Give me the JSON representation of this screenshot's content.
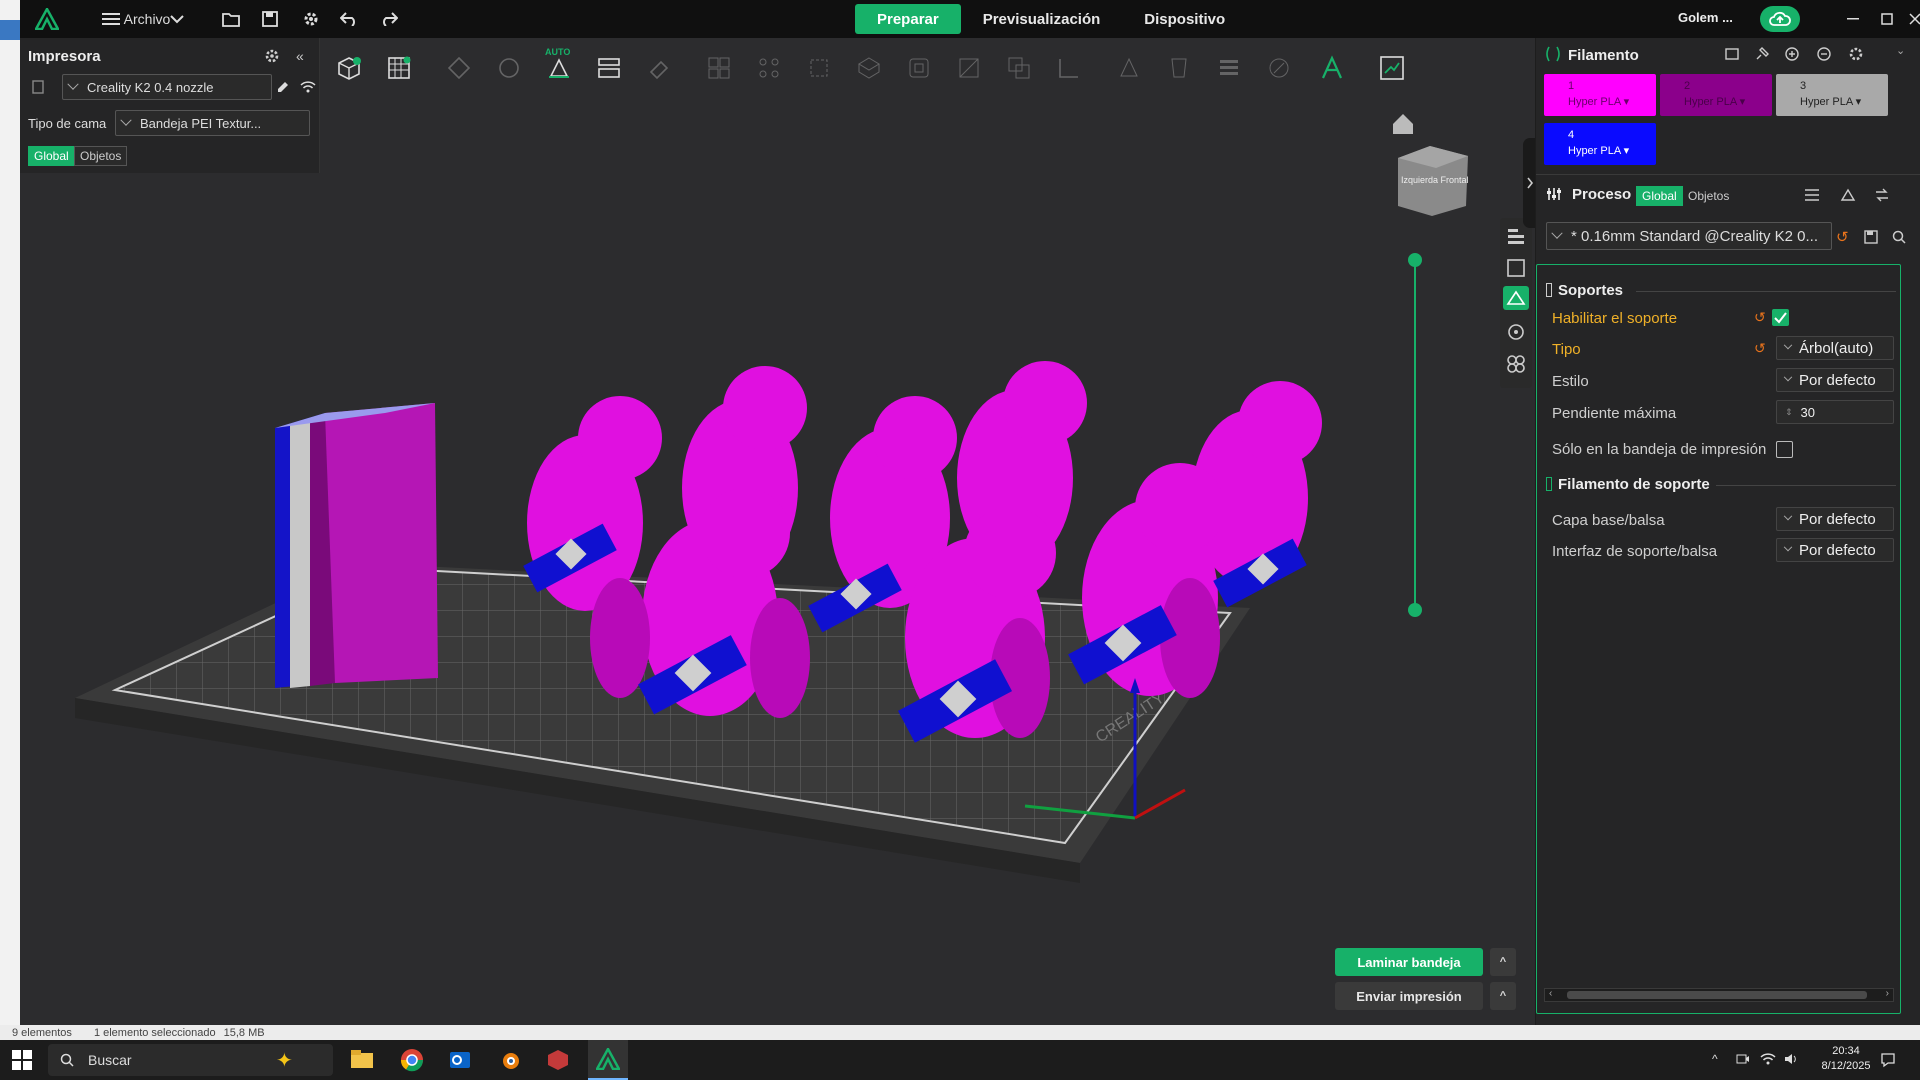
{
  "titlebar": {
    "menu_label": "Archivo",
    "tabs": [
      {
        "label": "Preparar",
        "active": true
      },
      {
        "label": "Previsualización",
        "active": false
      },
      {
        "label": "Dispositivo",
        "active": false
      }
    ],
    "project_name": "Golem ...",
    "accent": "#17b169"
  },
  "printer_panel": {
    "title": "Impresora",
    "printer": "Creality K2 0.4 nozzle",
    "bed_label": "Tipo de cama",
    "bed_value": "Bandeja PEI Textur...",
    "scope_global": "Global",
    "scope_objects": "Objetos"
  },
  "toolbar": {
    "auto_label": "AUTO",
    "icons": [
      "add-object-icon",
      "plate-grid-icon",
      "auto-orient-icon",
      "rotate-icon",
      "auto-arrange-icon",
      "split-plates-icon",
      "erase-icon",
      "layout-icon",
      "distribute-icon",
      "fit-icon",
      "support-paint-icon",
      "hollow-icon",
      "cut-icon",
      "boolean-icon",
      "measure-icon",
      "emboss-icon",
      "seam-icon",
      "layers-icon",
      "paint-icon",
      "text-a-icon",
      "assembly-icon"
    ]
  },
  "viewport": {
    "view_cube_text": "Izquierda Frontal",
    "bed_brand": "CREALITY"
  },
  "filament": {
    "title": "Filamento",
    "slots": [
      {
        "index": "1",
        "name": "Hyper PLA",
        "color": "#ff00ff",
        "text_color": "#6a006a"
      },
      {
        "index": "2",
        "name": "Hyper PLA",
        "color": "#8b008b",
        "text_color": "#4a004a"
      },
      {
        "index": "3",
        "name": "Hyper PLA",
        "color": "#a9a9a9",
        "text_color": "#222222"
      },
      {
        "index": "4",
        "name": "Hyper PLA",
        "color": "#0a0aff",
        "text_color": "#ffffff"
      }
    ]
  },
  "process": {
    "title": "Proceso",
    "scope_global": "Global",
    "scope_objects": "Objetos",
    "profile": "* 0.16mm Standard @Creality K2 0..."
  },
  "supports": {
    "section_title": "Soportes",
    "enable_label": "Habilitar el soporte",
    "enable_checked": true,
    "type_label": "Tipo",
    "type_value": "Árbol(auto)",
    "style_label": "Estilo",
    "style_value": "Por defecto",
    "max_slope_label": "Pendiente máxima",
    "max_slope_value": "30",
    "only_plate_label": "Sólo en la bandeja de impresión",
    "support_filament_title": "Filamento de soporte",
    "base_label": "Capa base/balsa",
    "base_value": "Por defecto",
    "interface_label": "Interfaz de soporte/balsa",
    "interface_value": "Por defecto"
  },
  "actions": {
    "slice": "Laminar bandeja",
    "send": "Enviar impresión"
  },
  "statusbar": {
    "elements": "9 elementos",
    "selected": "1 elemento seleccionado",
    "size": "15,8 MB"
  },
  "taskbar": {
    "search_placeholder": "Buscar",
    "time": "20:34",
    "date": "8/12/2025"
  }
}
